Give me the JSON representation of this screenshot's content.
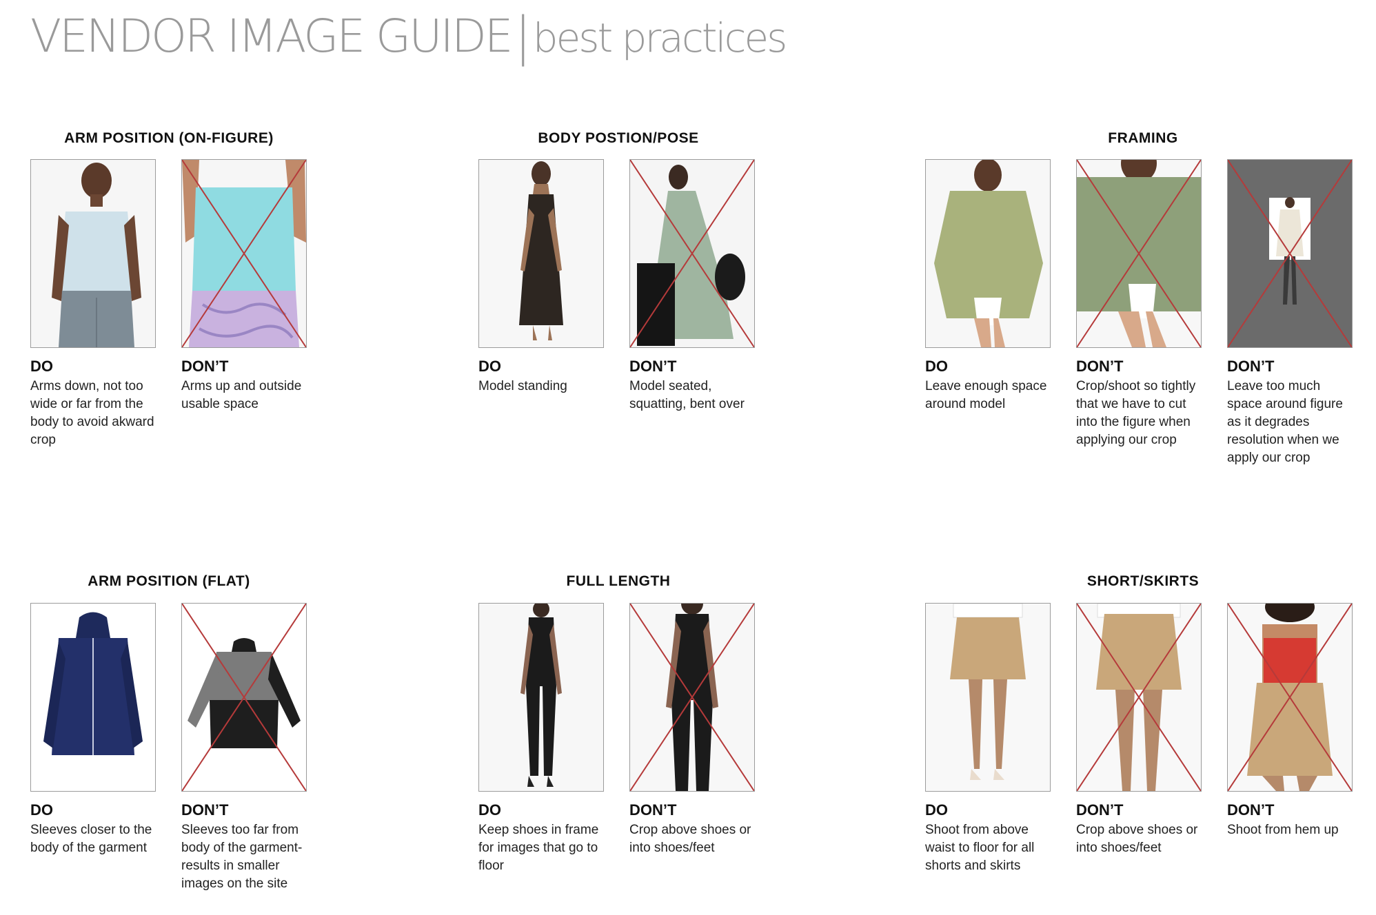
{
  "header": {
    "title_main": "VENDOR IMAGE GUIDE",
    "separator": "|",
    "title_sub": "best practices"
  },
  "sections": {
    "arm_on_figure": {
      "title": "ARM POSITION (ON-FIGURE)",
      "do": {
        "label": "DO",
        "text": "Arms down, not too wide or far from the body to avoid akward crop",
        "image": "tank-top-arms-down-photo"
      },
      "dont": {
        "label": "DON’T",
        "text": "Arms up and outside usable space",
        "image": "tank-top-arms-up-photo"
      }
    },
    "body_pose": {
      "title": "BODY POSTION/POSE",
      "do": {
        "label": "DO",
        "text": "Model standing",
        "image": "black-maxi-dress-standing-photo"
      },
      "dont": {
        "label": "DON’T",
        "text": "Model seated, squatting, bent over",
        "image": "green-maxi-dress-seated-photo"
      }
    },
    "framing": {
      "title": "FRAMING",
      "do": {
        "label": "DO",
        "text": "Leave enough space around model",
        "image": "green-shirt-framed-photo"
      },
      "dont_tight": {
        "label": "DON’T",
        "text": "Crop/shoot so tightly that we have to cut into the figure when applying our crop",
        "image": "green-shirt-tight-crop-photo"
      },
      "dont_loose": {
        "label": "DON’T",
        "text": "Leave too much space around figure as it degrades resolution when we apply our crop",
        "image": "small-figure-gray-background-photo"
      }
    },
    "arm_flat": {
      "title": "ARM POSITION (FLAT)",
      "do": {
        "label": "DO",
        "text": "Sleeves closer to the body of the garment",
        "image": "navy-jacket-flat-photo"
      },
      "dont": {
        "label": "DON’T",
        "text": "Sleeves too far from body of the garment-results in smaller images on the site",
        "image": "gray-black-jacket-flat-photo"
      }
    },
    "full_length": {
      "title": "FULL LENGTH",
      "do": {
        "label": "DO",
        "text": "Keep shoes in frame for images that go to floor",
        "image": "black-jumpsuit-full-photo"
      },
      "dont": {
        "label": "DON’T",
        "text": "Crop above shoes or into shoes/feet",
        "image": "black-jumpsuit-cropped-photo"
      }
    },
    "shorts_skirts": {
      "title": "SHORT/SKIRTS",
      "do": {
        "label": "DO",
        "text": "Shoot from above waist to floor for all shorts and skirts",
        "image": "khaki-shorts-full-photo"
      },
      "dont_crop": {
        "label": "DON’T",
        "text": "Crop above shoes or into shoes/feet",
        "image": "khaki-shorts-cropped-photo"
      },
      "dont_hem": {
        "label": "DON’T",
        "text": "Shoot from hem up",
        "image": "khaki-shorts-red-top-photo"
      }
    }
  },
  "colors": {
    "cross_red": "#b53a3a",
    "title_gray": "#9a9a9a",
    "frame_border": "#9b9b9b"
  }
}
